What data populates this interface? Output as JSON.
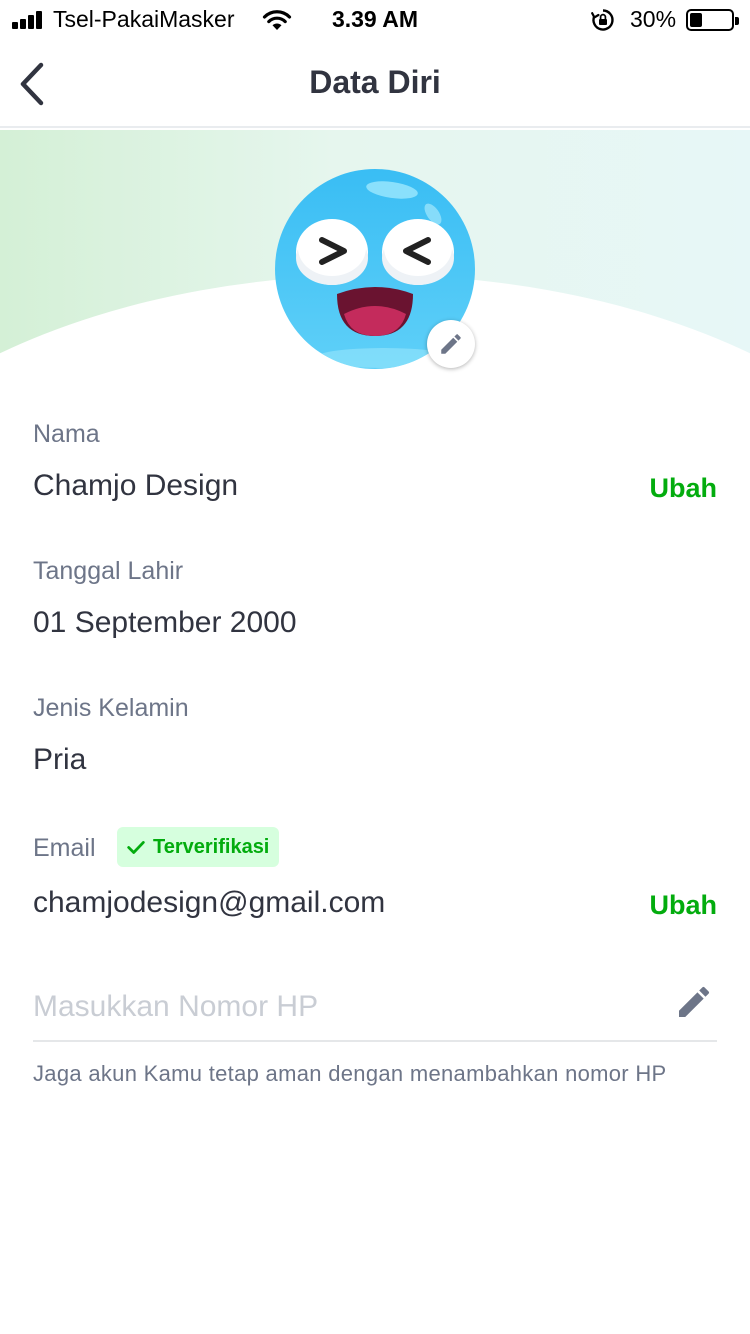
{
  "status_bar": {
    "carrier": "Tsel-PakaiMasker",
    "time": "3.39 AM",
    "battery_percent_text": "30%",
    "battery_level": 0.3,
    "signal_bars": 4
  },
  "header": {
    "title": "Data Diri",
    "back_icon": "chevron-left-icon"
  },
  "profile": {
    "avatar_icon": "emoji-avatar",
    "edit_icon": "pencil-icon"
  },
  "fields": {
    "name": {
      "label": "Nama",
      "value": "Chamjo Design",
      "action": "Ubah"
    },
    "birthdate": {
      "label": "Tanggal Lahir",
      "value": "01 September 2000"
    },
    "gender": {
      "label": "Jenis Kelamin",
      "value": "Pria"
    },
    "email": {
      "label": "Email",
      "badge": "Terverifikasi",
      "value": "chamjodesign@gmail.com",
      "action": "Ubah"
    },
    "phone": {
      "placeholder": "Masukkan Nomor HP",
      "value": "",
      "helper": "Jaga akun Kamu tetap aman dengan menambahkan nomor HP"
    }
  },
  "colors": {
    "accent_green": "#03ac0e",
    "badge_bg": "#d6ffde",
    "text_primary": "#313440",
    "text_secondary": "#6d7588",
    "avatar_blue": "#3fc4f5"
  }
}
